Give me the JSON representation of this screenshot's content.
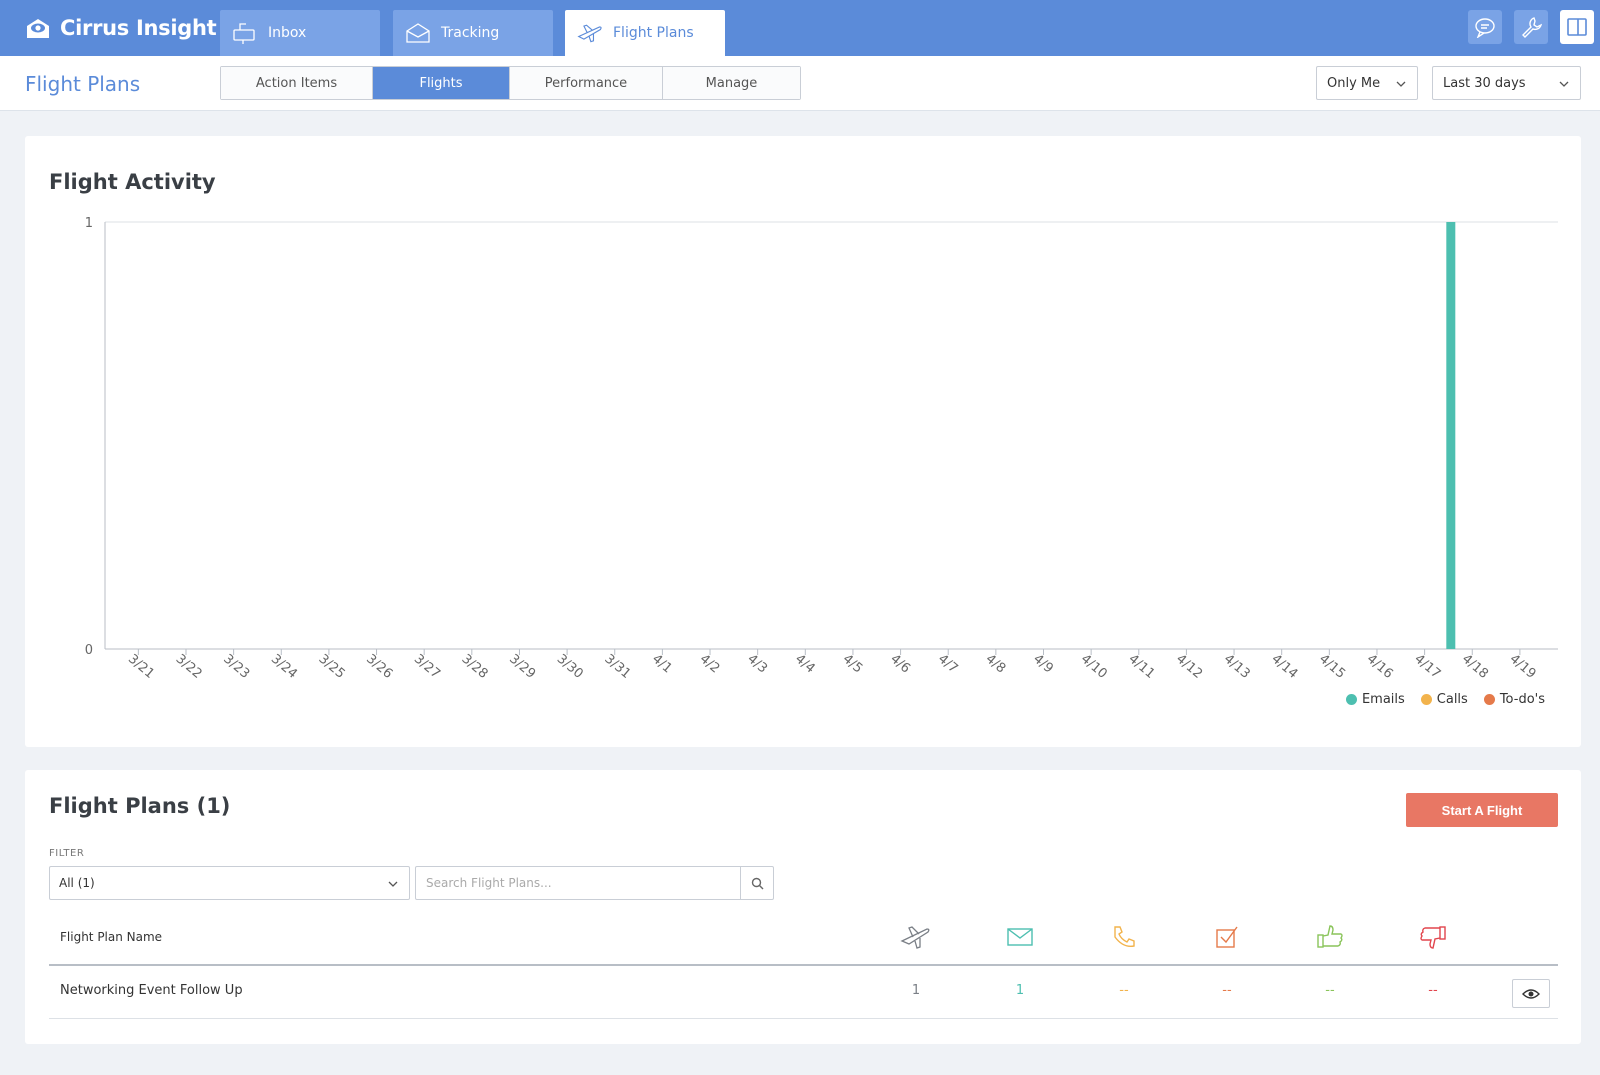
{
  "app": {
    "brand": "Cirrus Insight"
  },
  "nav": {
    "tabs": [
      {
        "label": "Inbox",
        "icon": "mailbox-icon"
      },
      {
        "label": "Tracking",
        "icon": "envelope-icon"
      },
      {
        "label": "Flight Plans",
        "icon": "airplane-icon",
        "active": true
      }
    ],
    "tools": [
      "chat-icon",
      "wrench-icon",
      "panel-icon"
    ]
  },
  "subheader": {
    "title": "Flight Plans",
    "segments": [
      {
        "label": "Action Items"
      },
      {
        "label": "Flights",
        "active": true
      },
      {
        "label": "Performance"
      },
      {
        "label": "Manage"
      }
    ],
    "owner_filter": "Only Me",
    "range_filter": "Last 30 days"
  },
  "activity": {
    "title": "Flight Activity"
  },
  "chart_data": {
    "type": "bar",
    "categories": [
      "3/21",
      "3/22",
      "3/23",
      "3/24",
      "3/25",
      "3/26",
      "3/27",
      "3/28",
      "3/29",
      "3/30",
      "3/31",
      "4/1",
      "4/2",
      "4/3",
      "4/4",
      "4/5",
      "4/6",
      "4/7",
      "4/8",
      "4/9",
      "4/10",
      "4/11",
      "4/12",
      "4/13",
      "4/14",
      "4/15",
      "4/16",
      "4/17",
      "4/18",
      "4/19"
    ],
    "series": [
      {
        "name": "Emails",
        "color": "#4dbfb0",
        "values": [
          0,
          0,
          0,
          0,
          0,
          0,
          0,
          0,
          0,
          0,
          0,
          0,
          0,
          0,
          0,
          0,
          0,
          0,
          0,
          0,
          0,
          0,
          0,
          0,
          0,
          0,
          0,
          0,
          1,
          0
        ]
      },
      {
        "name": "Calls",
        "color": "#f2b34c",
        "values": [
          0,
          0,
          0,
          0,
          0,
          0,
          0,
          0,
          0,
          0,
          0,
          0,
          0,
          0,
          0,
          0,
          0,
          0,
          0,
          0,
          0,
          0,
          0,
          0,
          0,
          0,
          0,
          0,
          0,
          0
        ]
      },
      {
        "name": "To-do's",
        "color": "#e57a4a",
        "values": [
          0,
          0,
          0,
          0,
          0,
          0,
          0,
          0,
          0,
          0,
          0,
          0,
          0,
          0,
          0,
          0,
          0,
          0,
          0,
          0,
          0,
          0,
          0,
          0,
          0,
          0,
          0,
          0,
          0,
          0
        ]
      }
    ],
    "yticks": [
      "0",
      "1"
    ],
    "ylim": [
      0,
      1
    ],
    "legend": "bottom-right",
    "grid": false
  },
  "plans": {
    "title": "Flight Plans (1)",
    "start_button": "Start A Flight",
    "filter_label": "FILTER",
    "filter_value": "All (1)",
    "search_placeholder": "Search Flight Plans...",
    "column_header": "Flight Plan Name",
    "column_icons": [
      {
        "icon": "airplane-icon",
        "color": "#7a7f86"
      },
      {
        "icon": "envelope-icon",
        "color": "#4dbfb0"
      },
      {
        "icon": "phone-icon",
        "color": "#f2b34c"
      },
      {
        "icon": "checkbox-icon",
        "color": "#e57a4a"
      },
      {
        "icon": "thumbs-up-icon",
        "color": "#8ac45a"
      },
      {
        "icon": "thumbs-down-icon",
        "color": "#e2454d"
      }
    ],
    "rows": [
      {
        "name": "Networking Event Follow Up",
        "values": [
          "1",
          "1",
          "--",
          "--",
          "--",
          "--"
        ]
      }
    ]
  }
}
